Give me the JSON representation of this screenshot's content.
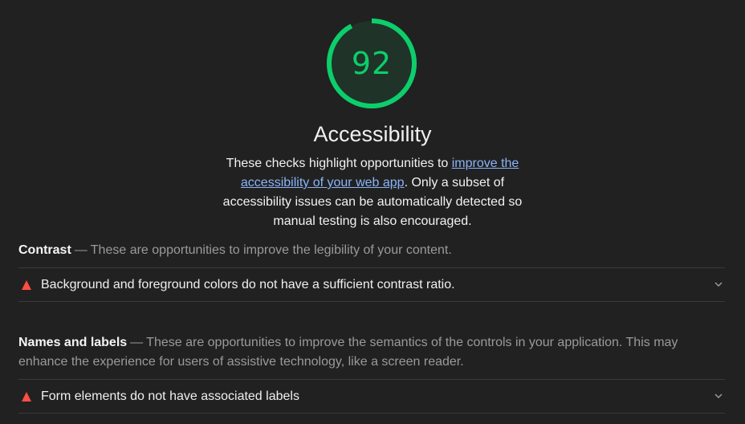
{
  "category": {
    "score": "92",
    "score_fraction": 0.92,
    "title": "Accessibility",
    "desc_before": "These checks highlight opportunities to ",
    "desc_link": "improve the accessibility of your web app",
    "desc_after": ". Only a subset of accessibility issues can be automatically detected so manual testing is also encouraged.",
    "colors": {
      "pass": "#0cce6b",
      "fail": "#ff4e42",
      "link": "#8ab4f8"
    }
  },
  "groups": [
    {
      "title": "Contrast",
      "separator": "—",
      "description": "These are opportunities to improve the legibility of your content.",
      "audits": [
        {
          "icon": "warning-triangle-icon",
          "title": "Background and foreground colors do not have a sufficient contrast ratio."
        }
      ]
    },
    {
      "title": "Names and labels",
      "separator": "—",
      "description": "These are opportunities to improve the semantics of the controls in your application. This may enhance the experience for users of assistive technology, like a screen reader.",
      "audits": [
        {
          "icon": "warning-triangle-icon",
          "title": "Form elements do not have associated labels"
        }
      ]
    }
  ]
}
